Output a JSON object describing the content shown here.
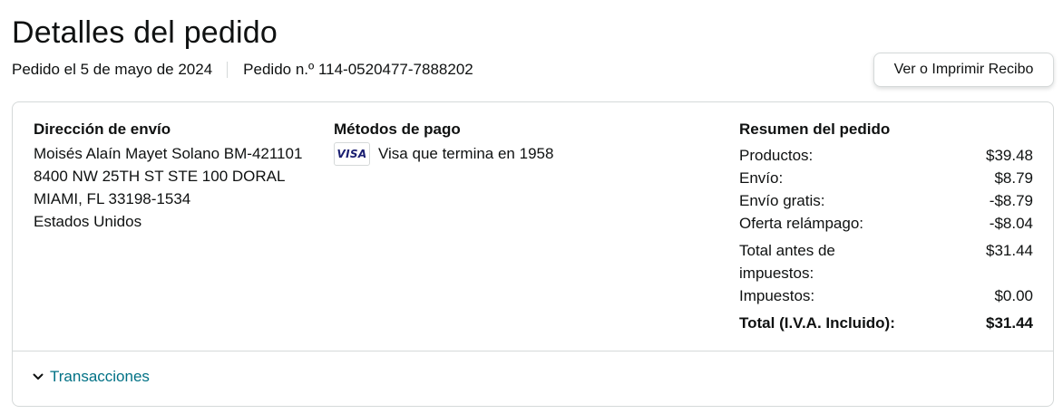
{
  "header": {
    "title": "Detalles del pedido",
    "order_date": "Pedido el 5 de mayo de 2024",
    "order_number": "Pedido n.º 114-0520477-7888202",
    "receipt_button": "Ver o Imprimir Recibo"
  },
  "shipping": {
    "heading": "Dirección de envío",
    "lines": [
      "Moisés Alaín Mayet Solano BM-421101",
      "8400 NW 25TH ST STE 100 DORAL",
      "MIAMI, FL 33198-1534",
      "Estados Unidos"
    ]
  },
  "payment": {
    "heading": "Métodos de pago",
    "card_brand": "VISA",
    "card_text": "Visa que termina en 1958"
  },
  "summary": {
    "heading": "Resumen del pedido",
    "rows": [
      {
        "label": "Productos:",
        "value": "$39.48"
      },
      {
        "label": "Envío:",
        "value": "$8.79"
      },
      {
        "label": "Envío gratis:",
        "value": "-$8.79"
      },
      {
        "label": "Oferta relámpago:",
        "value": "-$8.04"
      },
      {
        "label": "Total antes de impuestos:",
        "value": "$31.44"
      },
      {
        "label": "Impuestos:",
        "value": "$0.00"
      }
    ],
    "total_label": "Total (I.V.A. Incluido):",
    "total_value": "$31.44"
  },
  "transactions": {
    "label": "Transacciones",
    "icon": "chevron-down-icon"
  },
  "colors": {
    "link": "#007185",
    "border": "#d5d9d9",
    "text": "#0f1111",
    "visa": "#1a1f71"
  }
}
